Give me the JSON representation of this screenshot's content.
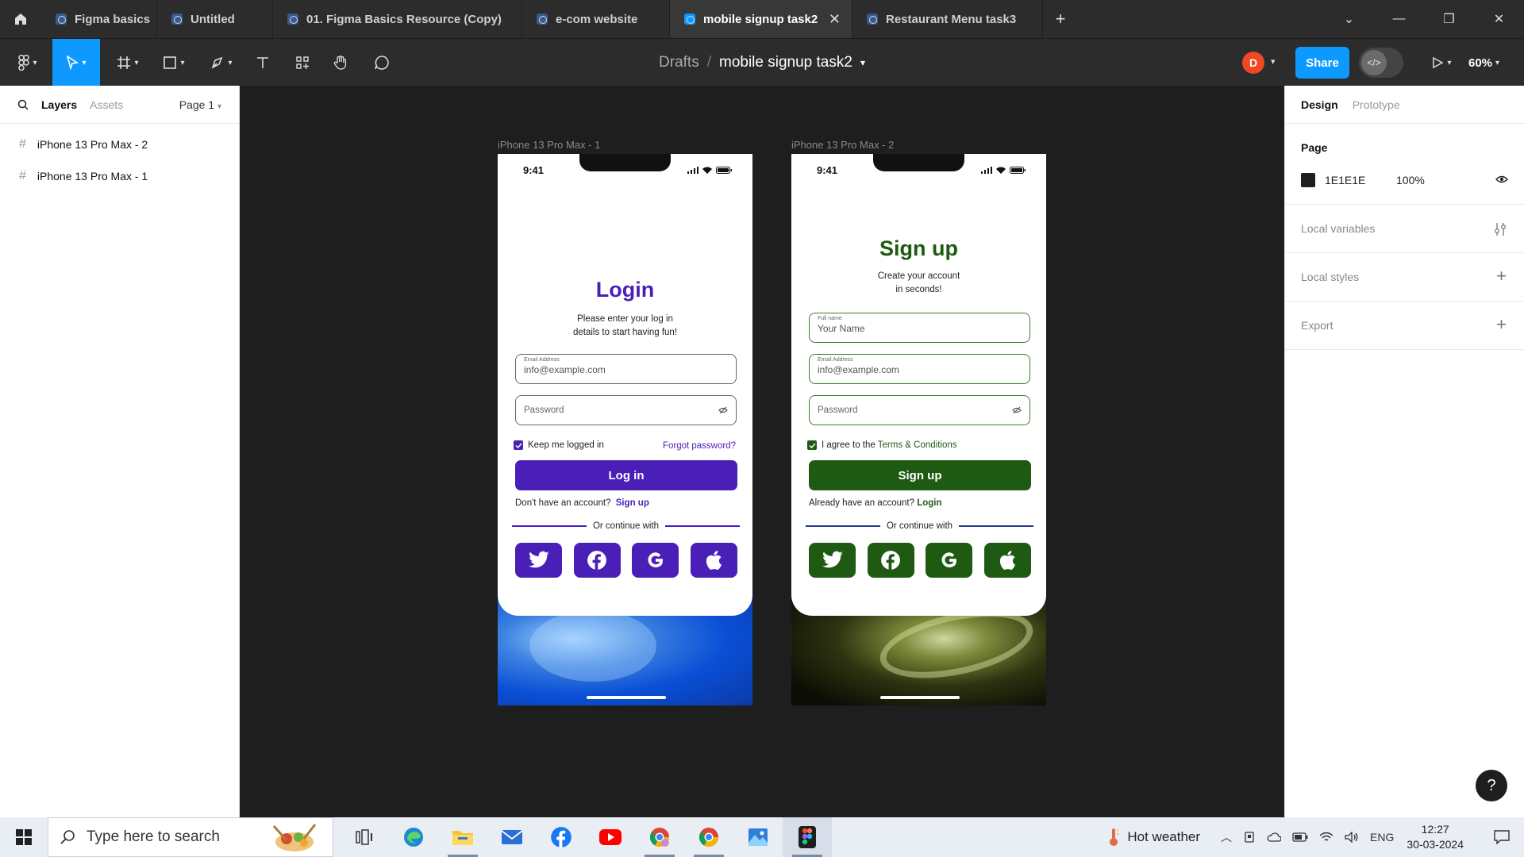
{
  "tabs": [
    {
      "label": "Figma basics"
    },
    {
      "label": "Untitled"
    },
    {
      "label": "01. Figma Basics Resource (Copy)"
    },
    {
      "label": "e-com website"
    },
    {
      "label": "mobile signup task2"
    },
    {
      "label": "Restaurant Menu task3"
    }
  ],
  "toolbar": {
    "breadcrumb_root": "Drafts",
    "file_name": "mobile signup task2",
    "avatar_initial": "D",
    "share_label": "Share",
    "zoom": "60%"
  },
  "left_panel": {
    "tab_layers": "Layers",
    "tab_assets": "Assets",
    "page_selector": "Page 1",
    "layers": [
      {
        "name": "iPhone 13 Pro Max - 2"
      },
      {
        "name": "iPhone 13 Pro Max - 1"
      }
    ]
  },
  "canvas": {
    "frames": [
      {
        "label": "iPhone 13 Pro Max - 1",
        "status_time": "9:41",
        "title": "Login",
        "subtitle_line1": "Please enter your log in",
        "subtitle_line2": "details to start having fun!",
        "email_label": "Email Address",
        "email_value": "info@example.com",
        "password_placeholder": "Password",
        "check_label": "Keep me logged in",
        "forgot_label": "Forgot password?",
        "button_label": "Log in",
        "account_text": "Don't have an account?",
        "account_link": "Sign up",
        "or_text": "Or continue with",
        "accent": "#4a1fb8"
      },
      {
        "label": "iPhone 13 Pro Max - 2",
        "status_time": "9:41",
        "title": "Sign up",
        "subtitle_line1": "Create your account",
        "subtitle_line2": "in seconds!",
        "name_label": "Full name",
        "name_placeholder": "Your Name",
        "email_label": "Email Address",
        "email_value": "info@example.com",
        "password_placeholder": "Password",
        "check_label_pre": "I agree to the",
        "check_label_link": "Terms & Conditions",
        "button_label": "Sign up",
        "account_text": "Already have an account?",
        "account_link": "Login",
        "or_text": "Or continue with",
        "accent": "#1e5a12"
      }
    ]
  },
  "right_panel": {
    "tab_design": "Design",
    "tab_prototype": "Prototype",
    "page_title": "Page",
    "page_color": "1E1E1E",
    "page_opacity": "100%",
    "local_variables": "Local variables",
    "local_styles": "Local styles",
    "export": "Export",
    "help": "?"
  },
  "taskbar": {
    "search_placeholder": "Type here to search",
    "weather": "Hot weather",
    "language": "ENG",
    "time": "12:27",
    "date": "30-03-2024"
  }
}
